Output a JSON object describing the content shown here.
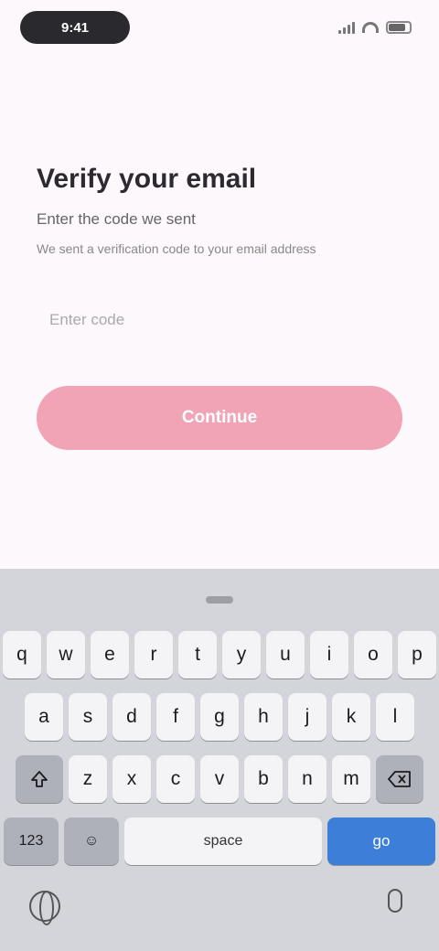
{
  "status_bar": {
    "time": "9:41"
  },
  "content": {
    "title": "Verify your email",
    "subtitle": "Enter the code we sent",
    "description": "We sent a verification code to your email address"
  },
  "form": {
    "code_placeholder": "Enter code",
    "continue_label": "Continue"
  },
  "keyboard": {
    "row1": [
      "q",
      "w",
      "e",
      "r",
      "t",
      "y",
      "u",
      "i",
      "o",
      "p"
    ],
    "row2": [
      "a",
      "s",
      "d",
      "f",
      "g",
      "h",
      "j",
      "k",
      "l"
    ],
    "row3": [
      "z",
      "x",
      "c",
      "v",
      "b",
      "n",
      "m"
    ],
    "shift_icon": "shift-icon",
    "delete_icon": "delete-icon",
    "numbers_label": "123",
    "emoji_label": "☺",
    "space_label": "space",
    "go_label": "go"
  },
  "colors": {
    "background": "#fdf8fb",
    "button": "#f0a4b5",
    "keyboard": "#d4d5db",
    "go_key": "#3c7ed8"
  }
}
